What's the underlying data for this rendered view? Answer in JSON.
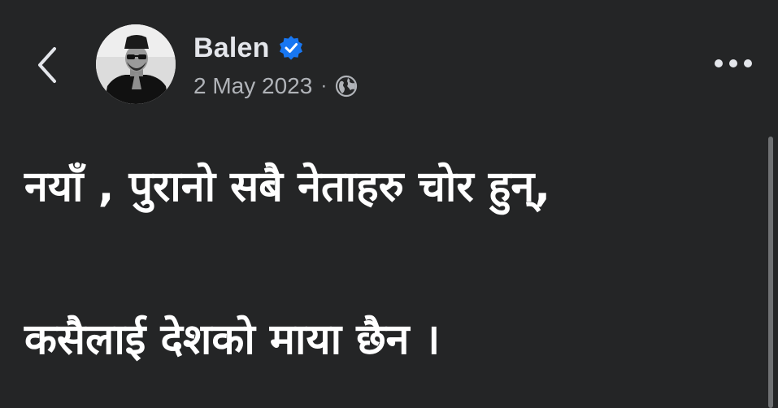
{
  "header": {
    "author_name": "Balen",
    "date": "2 May 2023",
    "separator": "·"
  },
  "icons": {
    "back": "chevron-left-icon",
    "verified": "verified-badge-icon",
    "privacy": "globe-icon",
    "more": "more-horizontal-icon"
  },
  "colors": {
    "background": "#242526",
    "verified_badge": "#1877f2",
    "text_primary": "#ffffff",
    "text_secondary": "#b0b3b8"
  },
  "post": {
    "lines": [
      "नयाँ , पुरानो सबै नेताहरु चोर हुन्,",
      "कसैलाई देशको माया छैन ।"
    ]
  }
}
